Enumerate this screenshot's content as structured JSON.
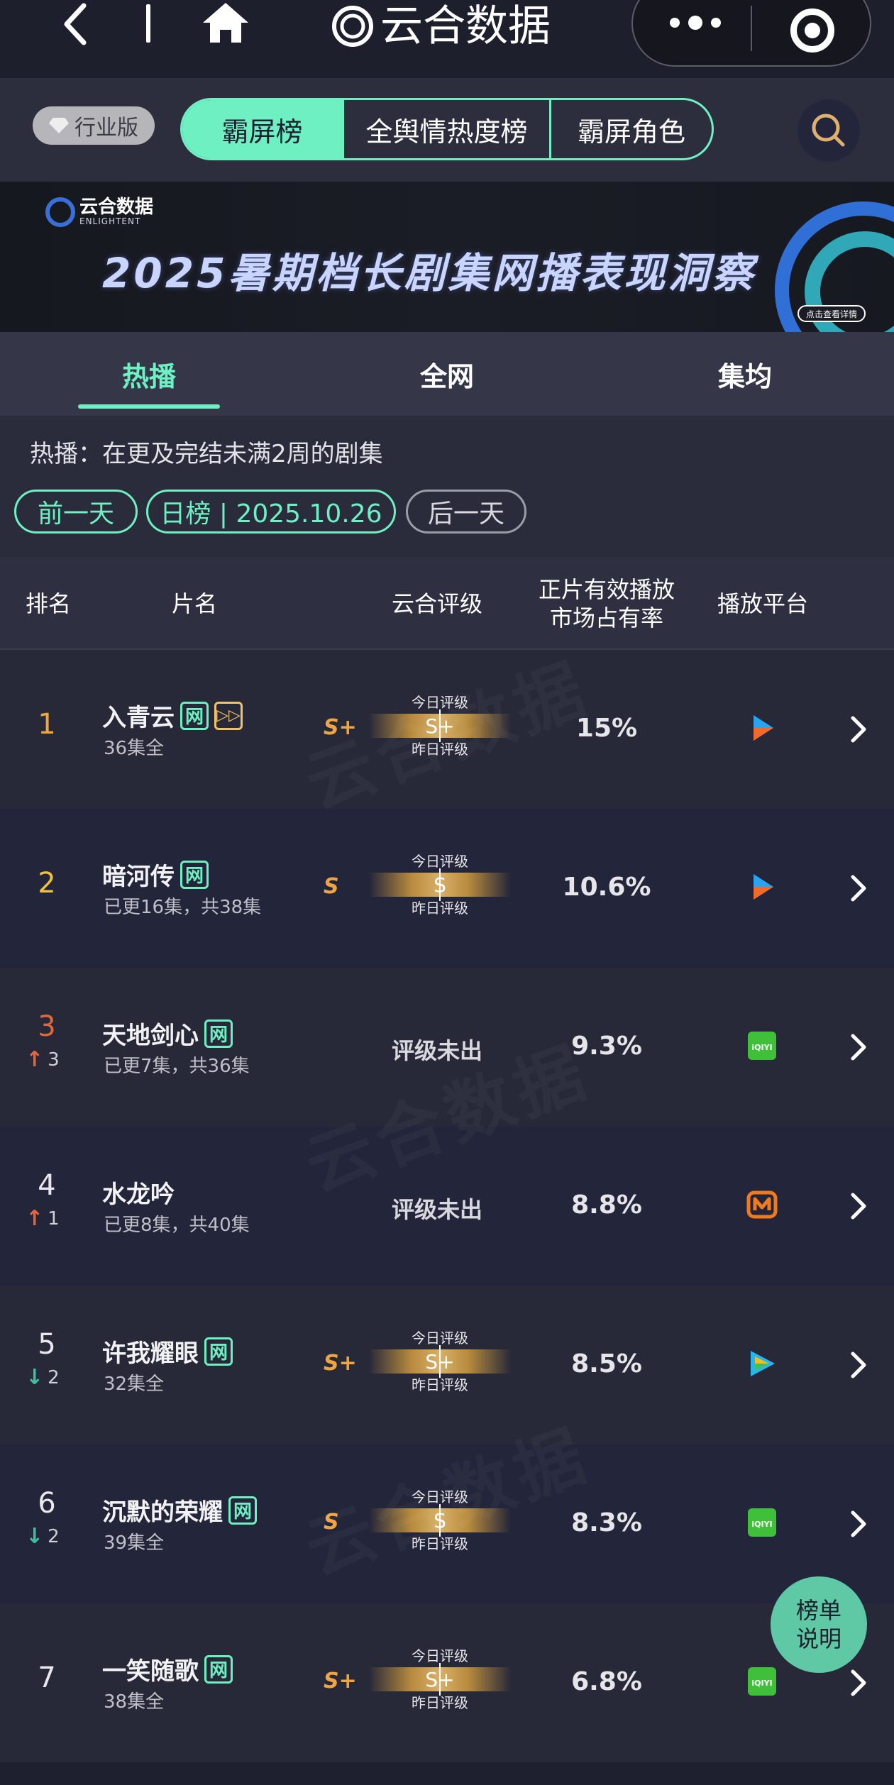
{
  "nav": {
    "title": "云合数据"
  },
  "tabs": {
    "industry": "行业版",
    "items": [
      "霸屏榜",
      "全舆情热度榜",
      "霸屏角色"
    ]
  },
  "banner": {
    "logo_cn": "云合数据",
    "logo_en": "ENLIGHTENT",
    "headline": "2025暑期档长剧集网播表现洞察",
    "cta": "点击查看详情"
  },
  "subtabs": [
    "热播",
    "全网",
    "集均"
  ],
  "info": "热播：在更及完结未满2周的剧集",
  "dates": {
    "prev": "前一天",
    "current": "日榜 | 2025.10.26",
    "next": "后一天"
  },
  "columns": {
    "rank": "排名",
    "name": "片名",
    "grade": "云合评级",
    "share": "正片有效播放\n市场占有率",
    "platform": "播放平台"
  },
  "grade_labels": {
    "today": "今日评级",
    "yesterday": "昨日评级",
    "none": "评级未出"
  },
  "rows": [
    {
      "rank": "1",
      "name": "入青云",
      "sub": "36集全",
      "yesterday": "S+",
      "today": "S+",
      "share": "15%",
      "platform": "youku-icon",
      "rank_color": "#f0a640"
    },
    {
      "rank": "2",
      "name": "暗河传",
      "sub": "已更16集，共38集",
      "yesterday": "S",
      "today": "S",
      "share": "10.6%",
      "platform": "youku-icon",
      "rank_color": "#f0c040"
    },
    {
      "rank": "3",
      "name": "天地剑心",
      "sub": "已更7集，共36集",
      "change": "3",
      "share": "9.3%",
      "platform": "iqiyi-icon",
      "rank_color": "#e0683a"
    },
    {
      "rank": "4",
      "name": "水龙吟",
      "sub": "已更8集，共40集",
      "change": "1",
      "share": "8.8%",
      "platform": "mango-tv-icon",
      "rank_color": "#e8e8ec"
    },
    {
      "rank": "5",
      "name": "许我耀眼",
      "sub": "32集全",
      "change": "2",
      "yesterday": "S+",
      "today": "S+",
      "share": "8.5%",
      "platform": "tencent-video-icon",
      "rank_color": "#e8e8ec"
    },
    {
      "rank": "6",
      "name": "沉默的荣耀",
      "sub": "39集全",
      "change": "2",
      "yesterday": "S",
      "today": "S",
      "share": "8.3%",
      "platform": "iqiyi-icon",
      "rank_color": "#e8e8ec"
    },
    {
      "rank": "7",
      "name": "一笑随歌",
      "sub": "38集全",
      "yesterday": "S+",
      "today": "S+",
      "share": "6.8%",
      "platform": "iqiyi-icon",
      "rank_color": "#e8e8ec"
    }
  ],
  "fab": "榜单\n说明",
  "watermark": "云合数据"
}
